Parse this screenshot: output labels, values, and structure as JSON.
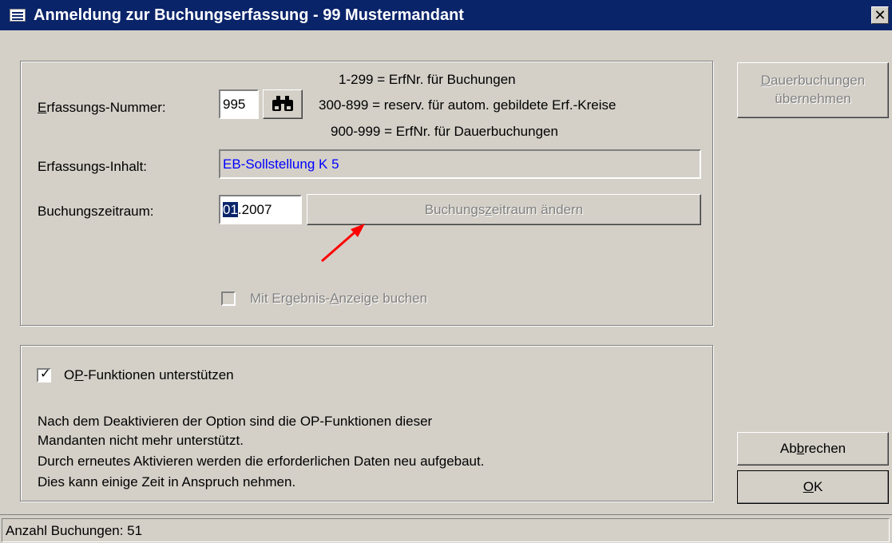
{
  "window": {
    "title": "Anmeldung zur Buchungserfassung - 99 Mustermandant",
    "close_label": "✕"
  },
  "form": {
    "erfassungs_nummer_label_u": "E",
    "erfassungs_nummer_label_rest": "rfassungs-Nummer:",
    "erfassungs_nummer_value": "995",
    "info_line1": "1-299 = ErfNr. für Buchungen",
    "info_line2": "300-899 = reserv. für autom. gebildete Erf.-Kreise",
    "info_line3": "900-999 = ErfNr. für Dauerbuchungen",
    "erfassungs_inhalt_label": "Erfassungs-Inhalt:",
    "erfassungs_inhalt_value": "EB-Sollstellung K 5",
    "buchungszeitraum_label": "Buchungszeitraum:",
    "buchungszeitraum_month": "01",
    "buchungszeitraum_year": ".2007",
    "buchungszeitraum_btn_a": "Buchungs",
    "buchungszeitraum_btn_u": "z",
    "buchungszeitraum_btn_b": "eitraum ändern",
    "ergebnis_label_a": "Mit Ergebnis-",
    "ergebnis_label_u": "A",
    "ergebnis_label_b": "nzeige buchen"
  },
  "op": {
    "checkbox_label_a": "O",
    "checkbox_label_u": "P",
    "checkbox_label_b": "-Funktionen unterstützen",
    "checked": true,
    "desc_line1": "Nach dem Deaktivieren der Option sind die OP-Funktionen dieser",
    "desc_line2": "Mandanten nicht mehr unterstützt.",
    "desc_line3": "Durch erneutes Aktivieren werden die erforderlichen Daten neu aufgebaut.",
    "desc_line4": "Dies kann einige Zeit in Anspruch nehmen."
  },
  "side": {
    "dauer_u": "D",
    "dauer_line1_rest": "auerbuchungen",
    "dauer_line2": "übernehmen",
    "abbrechen_a": "Ab",
    "abbrechen_u": "b",
    "abbrechen_b": "rechen",
    "ok_u": "O",
    "ok_b": "K"
  },
  "status": {
    "text": "Anzahl Buchungen: 51"
  },
  "colors": {
    "title_bg": "#0a246a",
    "face": "#d4d0c8",
    "inhalt_text": "#0000ff",
    "annotation_arrow": "#ff0000"
  },
  "icons": {
    "window": "app-window-icon",
    "search": "binoculars-icon",
    "close": "close-icon"
  }
}
